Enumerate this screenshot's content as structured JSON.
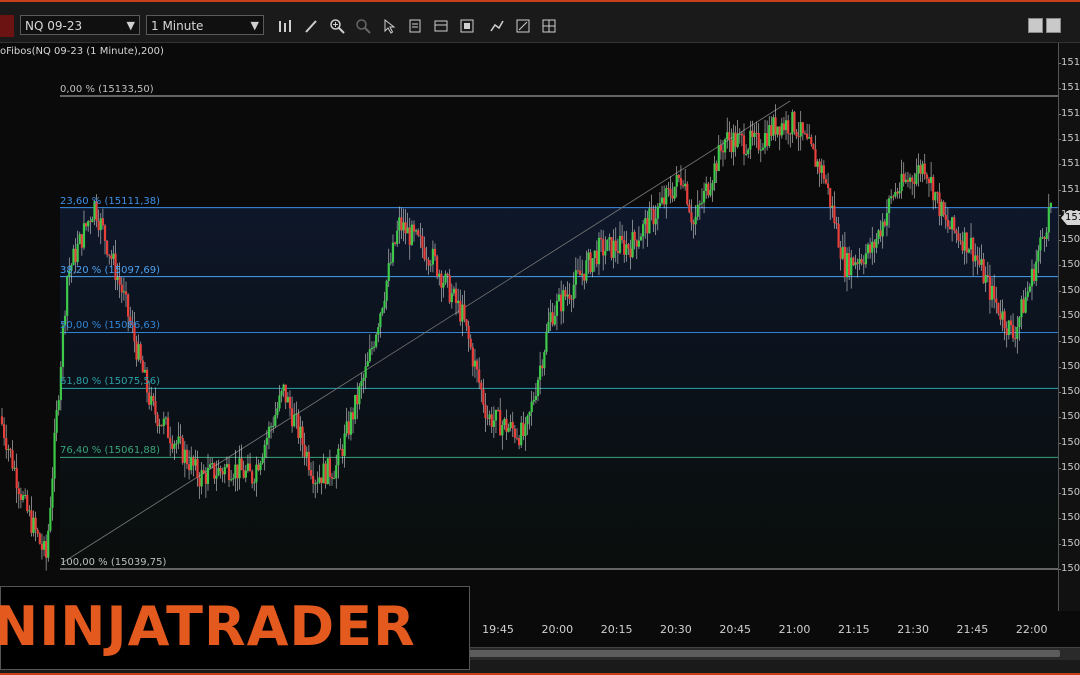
{
  "toolbar": {
    "instrument": "NQ 09-23",
    "interval": "1 Minute",
    "tools": [
      "bar-chart-icon",
      "pencil-icon",
      "zoom-in-icon",
      "zoom-out-icon",
      "cursor-icon",
      "data-box-icon",
      "chart-style-icon",
      "strategies-icon",
      "drawing-tools-icon",
      "properties-icon",
      "grid-icon"
    ]
  },
  "chart": {
    "title": "oFibos(NQ 09-23 (1 Minute),200)",
    "fib_levels": [
      {
        "label": "0,00 % (15133,50)",
        "price": 15133.5,
        "color": "#bfbfbf"
      },
      {
        "label": "23,60 % (15111,38)",
        "price": 15111.38,
        "color": "#3c8fe6"
      },
      {
        "label": "38,20 % (15097,69)",
        "price": 15097.69,
        "color": "#4aa0ee"
      },
      {
        "label": "50,00 % (15086,63)",
        "price": 15086.63,
        "color": "#2f85d4"
      },
      {
        "label": "61,80 % (15075,56)",
        "price": 15075.56,
        "color": "#2aa0a8"
      },
      {
        "label": "76,40 % (15061,88)",
        "price": 15061.88,
        "color": "#3aa37a"
      },
      {
        "label": "100,00 % (15039,75)",
        "price": 15039.75,
        "color": "#bfbfbf"
      }
    ],
    "y_ticks": [
      "151",
      "151",
      "151",
      "151",
      "151",
      "151",
      "151",
      "150",
      "150",
      "150",
      "150",
      "150",
      "150",
      "150",
      "150",
      "150",
      "150",
      "150",
      "150",
      "150",
      "150"
    ],
    "x_ticks": [
      "19:45",
      "20:00",
      "20:15",
      "20:30",
      "20:45",
      "21:00",
      "21:15",
      "21:30",
      "21:45",
      "22:00"
    ],
    "up_color": "#3ec94a",
    "down_color": "#e8403a",
    "current_marker": "151"
  },
  "brand": {
    "logo_text": "NINJATRADER",
    "accent": "#e45a1e"
  }
}
